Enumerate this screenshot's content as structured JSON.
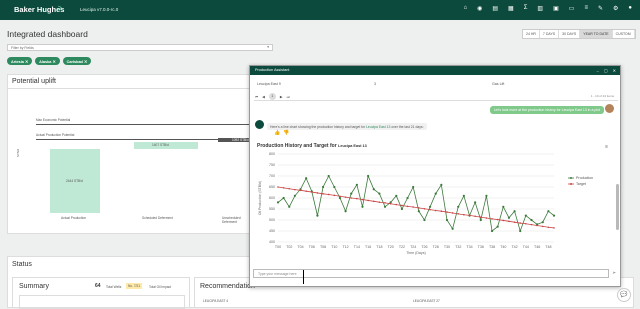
{
  "topbar": {
    "brand": "Baker Hughes",
    "app_version": "Leucipa v7.0.0-rc.0"
  },
  "page": {
    "title": "Integrated dashboard"
  },
  "range_tabs": [
    "24 HR",
    "7 DAYS",
    "30 DAYS",
    "YEAR TO DATE",
    "CUSTOM"
  ],
  "filter": {
    "placeholder": "Filter by Fields"
  },
  "chips": [
    "Artesia",
    "Alaska",
    "Carlsbad"
  ],
  "uplift": {
    "title": "Potential uplift",
    "y_axis_label": "STB/d",
    "legend_max": "Max Economic Potential",
    "legend_actual": "Actual Production Potential",
    "bars": [
      {
        "label": "Actual Production",
        "value_label": "2444 STB/d"
      },
      {
        "label": "Scheduled Deferment",
        "value_label": "1407 STB/d"
      },
      {
        "label": "Unscheduled Deferment",
        "value_label": "1092 STB/d"
      }
    ]
  },
  "status": {
    "title": "Status"
  },
  "summary": {
    "title": "Summary",
    "count": "64",
    "count_label": "Total Wells",
    "badge": "No. 7/21",
    "impact_label": "Total Oil Impact"
  },
  "recommendation": {
    "title": "Recommendation",
    "item1": "LEUCIPA EAST 4",
    "item2": "LEUCIPA EAST 27"
  },
  "modal": {
    "title": "Production Assistant",
    "row_well": "Leucipa East 9",
    "row_value": "3",
    "row_lift": "Gas Lift",
    "pager_current": "1",
    "pager_info": "1 - 10 of 24 items",
    "user_message": "Let's look more at the production history for Leucipa East 13 in a plot",
    "bot_message_prefix": "Here's a line chart showing the production history and target for",
    "bot_message_well": "Leucipa East 13",
    "bot_message_suffix": "over the last 21 days:",
    "chart_title": "Production History and Target for",
    "chart_title_well": "Leucipa East 13",
    "input_placeholder": "Type your message here"
  },
  "chart_data": {
    "type": "line",
    "title": "Production History and Target for Leucipa East 13",
    "xlabel": "Time (Days)",
    "ylabel": "Oil Production (STB/d)",
    "x": [
      "T00",
      "T01",
      "T02",
      "T03",
      "T04",
      "T05",
      "T06",
      "T07",
      "T08",
      "T09",
      "T10",
      "T11",
      "T12",
      "T13",
      "T14",
      "T15",
      "T16",
      "T17",
      "T18",
      "T19",
      "T20",
      "T21",
      "T22",
      "T23",
      "T24",
      "T25",
      "T26",
      "T27",
      "T28",
      "T29",
      "T30",
      "T31",
      "T32",
      "T33",
      "T34",
      "T35",
      "T36",
      "T37",
      "T38",
      "T39",
      "T40",
      "T41",
      "T42",
      "T43",
      "T44",
      "T45",
      "T46",
      "T47",
      "T48",
      "T49"
    ],
    "x_ticks": [
      "T00",
      "T02",
      "T04",
      "T06",
      "T08",
      "T10",
      "T12",
      "T14",
      "T16",
      "T18",
      "T20",
      "T22",
      "T24",
      "T26",
      "T28",
      "T30",
      "T32",
      "T34",
      "T36",
      "T38",
      "T40",
      "T42",
      "T44",
      "T46",
      "T48"
    ],
    "ylim": [
      400,
      800
    ],
    "yticks": [
      400,
      450,
      500,
      550,
      600,
      650,
      700,
      750,
      800
    ],
    "grid": true,
    "legend_position": "right",
    "series": [
      {
        "name": "Production",
        "color": "#3d7a3d",
        "values": [
          580,
          600,
          560,
          610,
          640,
          690,
          630,
          520,
          650,
          700,
          650,
          600,
          540,
          620,
          660,
          560,
          700,
          640,
          620,
          560,
          580,
          610,
          550,
          600,
          650,
          540,
          500,
          560,
          620,
          660,
          500,
          460,
          560,
          610,
          520,
          580,
          500,
          610,
          450,
          470,
          560,
          510,
          540,
          450,
          520,
          500,
          480,
          490,
          540,
          520
        ]
      },
      {
        "name": "Target",
        "color": "#c94444",
        "values": [
          650,
          646,
          642,
          638,
          635,
          631,
          627,
          623,
          619,
          616,
          612,
          608,
          604,
          600,
          597,
          593,
          589,
          585,
          581,
          578,
          574,
          570,
          566,
          562,
          559,
          555,
          551,
          547,
          543,
          540,
          536,
          532,
          528,
          524,
          521,
          517,
          513,
          509,
          505,
          502,
          498,
          494,
          490,
          486,
          483,
          479,
          475,
          471,
          467,
          464
        ]
      }
    ]
  }
}
